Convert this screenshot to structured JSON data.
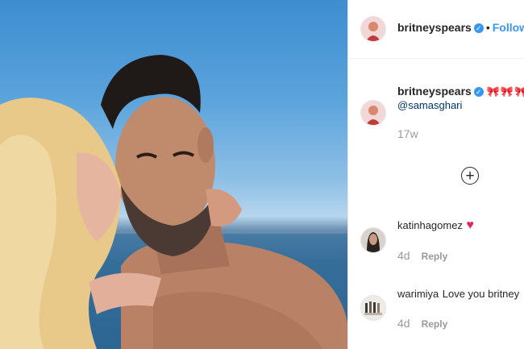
{
  "post_header": {
    "username": "britneyspears",
    "follow_label": "Follow",
    "separator": "•"
  },
  "caption": {
    "username": "britneyspears",
    "emoji": "🎀🎀🎀",
    "mention": "@samasghari",
    "time": "17w"
  },
  "comments": [
    {
      "username": "katinhagomez",
      "text": "",
      "emoji": "♥",
      "time": "4d",
      "reply_label": "Reply"
    },
    {
      "username": "warimiya",
      "text": "Love you britney",
      "time": "4d",
      "reply_label": "Reply"
    }
  ],
  "load_more_icon": "plus-circle-icon",
  "colors": {
    "accent": "#3897f0",
    "text": "#262626",
    "muted": "#999999",
    "heart": "#e0245e"
  }
}
